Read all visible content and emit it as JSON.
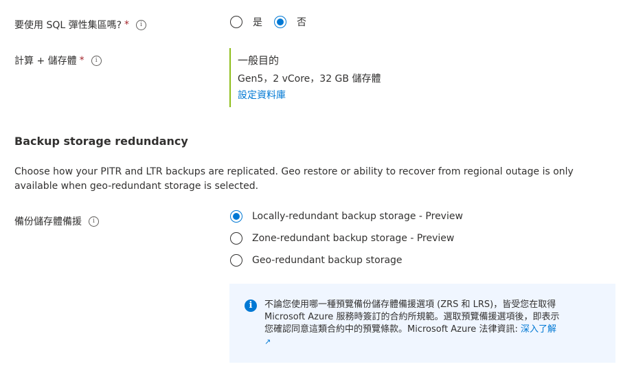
{
  "sql_elastic_pool": {
    "label": "要使用 SQL 彈性集區嗎?",
    "required_mark": "*",
    "info_glyph": "i",
    "options": [
      {
        "label": "是",
        "selected": false
      },
      {
        "label": "否",
        "selected": true
      }
    ]
  },
  "compute_storage": {
    "label": "計算 + 儲存體",
    "required_mark": "*",
    "info_glyph": "i",
    "tier": "一般目的",
    "details": "Gen5，2 vCore，32 GB 儲存體",
    "configure_link": "設定資料庫"
  },
  "backup": {
    "section_title": "Backup storage redundancy",
    "description_line1": "Choose how your PITR and LTR backups are replicated. Geo restore or ability to recover from regional outage is only",
    "description_line2": "available when geo-redundant storage is selected.",
    "label": "備份儲存體備援",
    "info_glyph": "i",
    "options": [
      {
        "label": "Locally-redundant backup storage - Preview",
        "selected": true
      },
      {
        "label": "Zone-redundant backup storage - Preview",
        "selected": false
      },
      {
        "label": "Geo-redundant backup storage",
        "selected": false
      }
    ]
  },
  "notice": {
    "icon_glyph": "i",
    "line1": "不論您使用哪一種預覽備份儲存體備援選項 (ZRS 和 LRS)，皆受您在取得",
    "line2": "Microsoft Azure 服務時簽訂的合約所規範。選取預覽備援選項後，即表示",
    "line3_prefix": "您確認同意這類合約中的預覽條款。Microsoft Azure 法律資訊: ",
    "learn_more": "深入了解",
    "external_glyph": "↗"
  },
  "colors": {
    "accent": "#0078d4",
    "required": "#a4262c",
    "compute_border": "#8cbd18",
    "notice_bg": "#f0f6ff"
  }
}
